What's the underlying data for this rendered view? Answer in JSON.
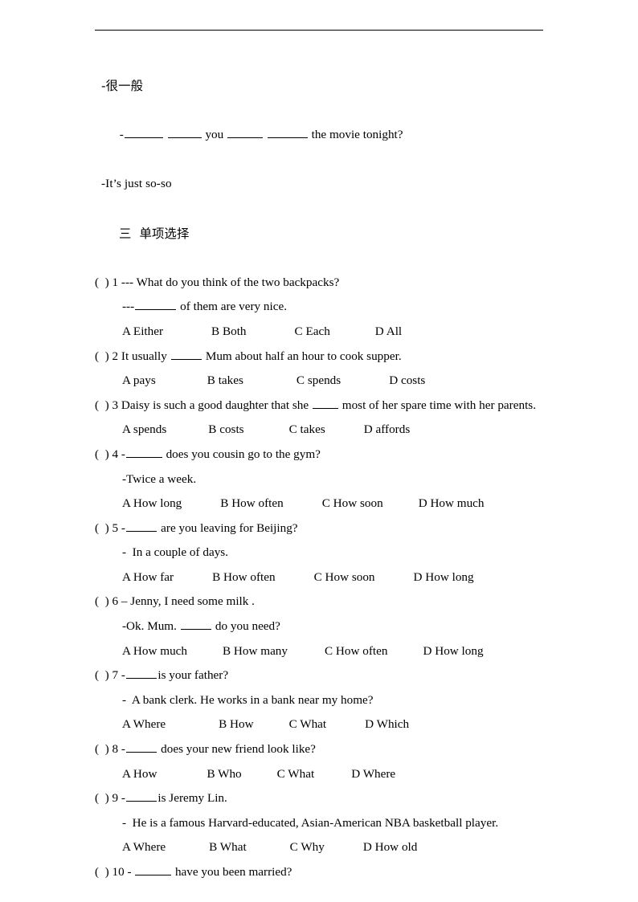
{
  "document": {
    "header_rule": true,
    "intro": {
      "answer_line": "-很一般",
      "question_line_prefix": "-",
      "question_line_mid1": " you ",
      "question_line_mid2": " ",
      "question_line_suffix": " the movie tonight?",
      "response_line": "-It’s just so-so"
    },
    "section": {
      "number": "三",
      "title": "单项选择"
    },
    "questions": [
      {
        "marker": "(  ) 1",
        "stem": "(  ) 1 --- What do you think of the two backpacks?",
        "sub_lines": [
          "---________ of them are very nice."
        ],
        "options": [
          "A Either",
          "B Both",
          "C Each",
          "D All"
        ],
        "option_gaps": [
          60,
          60,
          56
        ]
      },
      {
        "marker": "(  ) 2",
        "stem": "(  ) 2 It usually ______ Mum about half an hour to cook supper.",
        "sub_lines": [],
        "options": [
          "A pays",
          "B takes",
          "C spends",
          "D costs"
        ],
        "option_gaps": [
          64,
          66,
          60
        ]
      },
      {
        "marker": "(  ) 3",
        "stem": "(  ) 3 Daisy is such a good daughter that she _____ most of her spare time with her parents.",
        "sub_lines": [],
        "options": [
          "A spends",
          "B costs",
          "C takes",
          "D affords"
        ],
        "option_gaps": [
          52,
          56,
          48
        ]
      },
      {
        "marker": "(  ) 4",
        "stem": "(  ) 4 -_______ does you cousin go to the gym?",
        "sub_lines": [
          "-Twice a week."
        ],
        "options": [
          "A How long",
          "B How often",
          "C How soon",
          "D How much"
        ],
        "option_gaps": [
          48,
          48,
          44
        ]
      },
      {
        "marker": "(  ) 5",
        "stem": "(  ) 5 -______ are you leaving for Beijing?",
        "sub_lines": [
          "-  In a couple of days."
        ],
        "options": [
          "A How far",
          "B How often",
          "C How soon",
          "D How long"
        ],
        "option_gaps": [
          48,
          48,
          48
        ]
      },
      {
        "marker": "(  ) 6",
        "stem": "(  ) 6 – Jenny, I need some milk .",
        "sub_lines": [
          "-Ok. Mum. ______ do you need?"
        ],
        "options": [
          "A How much",
          "B How many",
          "C How often",
          "D How long"
        ],
        "option_gaps": [
          44,
          46,
          44
        ]
      },
      {
        "marker": "(  ) 7",
        "stem": "(  ) 7 -______is your father?",
        "sub_lines": [
          "-  A bank clerk. He works in a bank near my home?"
        ],
        "options": [
          "A Where",
          "B How",
          "C What",
          "D Which"
        ],
        "option_gaps": [
          66,
          44,
          48
        ]
      },
      {
        "marker": "(  ) 8",
        "stem": "(  ) 8 -______ does your new friend look like?",
        "sub_lines": [],
        "options": [
          "A How",
          "B Who",
          "C What",
          "D Where"
        ],
        "option_gaps": [
          62,
          44,
          46
        ]
      },
      {
        "marker": "(  ) 9",
        "stem": "(  ) 9 -______is Jeremy Lin.",
        "sub_lines": [
          "-  He is a famous Harvard-educated, Asian-American NBA basketball player."
        ],
        "options": [
          "A Where",
          "B What",
          "C Why",
          "D How old"
        ],
        "option_gaps": [
          54,
          54,
          48
        ]
      },
      {
        "marker": "(  ) 10",
        "stem": "(  ) 10 - _______ have you been married?",
        "sub_lines": [],
        "options": [],
        "option_gaps": []
      }
    ]
  }
}
